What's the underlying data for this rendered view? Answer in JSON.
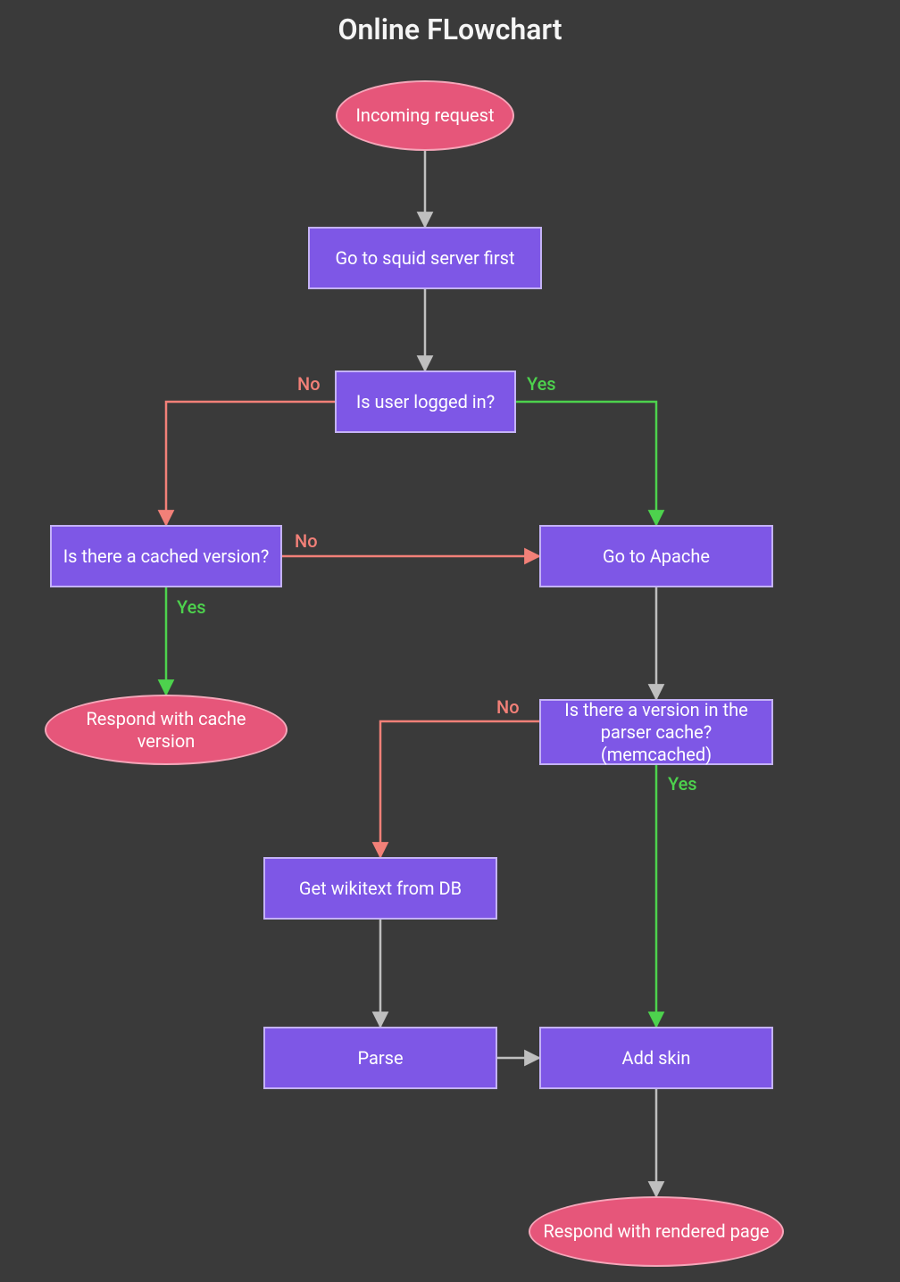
{
  "title": "Online FLowchart",
  "nodes": {
    "start": {
      "label": "Incoming request"
    },
    "squid": {
      "label": "Go to squid server first"
    },
    "logged_in": {
      "label": "Is user logged in?"
    },
    "cached": {
      "label": "Is there a cached version?"
    },
    "apache": {
      "label": "Go to Apache"
    },
    "respond_cache": {
      "label": "Respond with cache version"
    },
    "memcached": {
      "label": "Is there a version in the parser cache? (memcached)"
    },
    "wikitext": {
      "label": "Get wikitext from DB"
    },
    "parse": {
      "label": "Parse"
    },
    "addskin": {
      "label": "Add skin"
    },
    "respond_page": {
      "label": "Respond with rendered page"
    }
  },
  "edge_labels": {
    "logged_in_no": "No",
    "logged_in_yes": "Yes",
    "cached_yes": "Yes",
    "cached_no": "No",
    "memcached_no": "No",
    "memcached_yes": "Yes"
  },
  "colors": {
    "bg": "#3a3a3a",
    "rect_fill": "#7e57e6",
    "rect_border": "#c4b2f6",
    "term_fill": "#e6567a",
    "term_border": "#f4a6b9",
    "arrow_default": "#bfbfbf",
    "arrow_yes": "#4dd24d",
    "arrow_no": "#f28078"
  }
}
